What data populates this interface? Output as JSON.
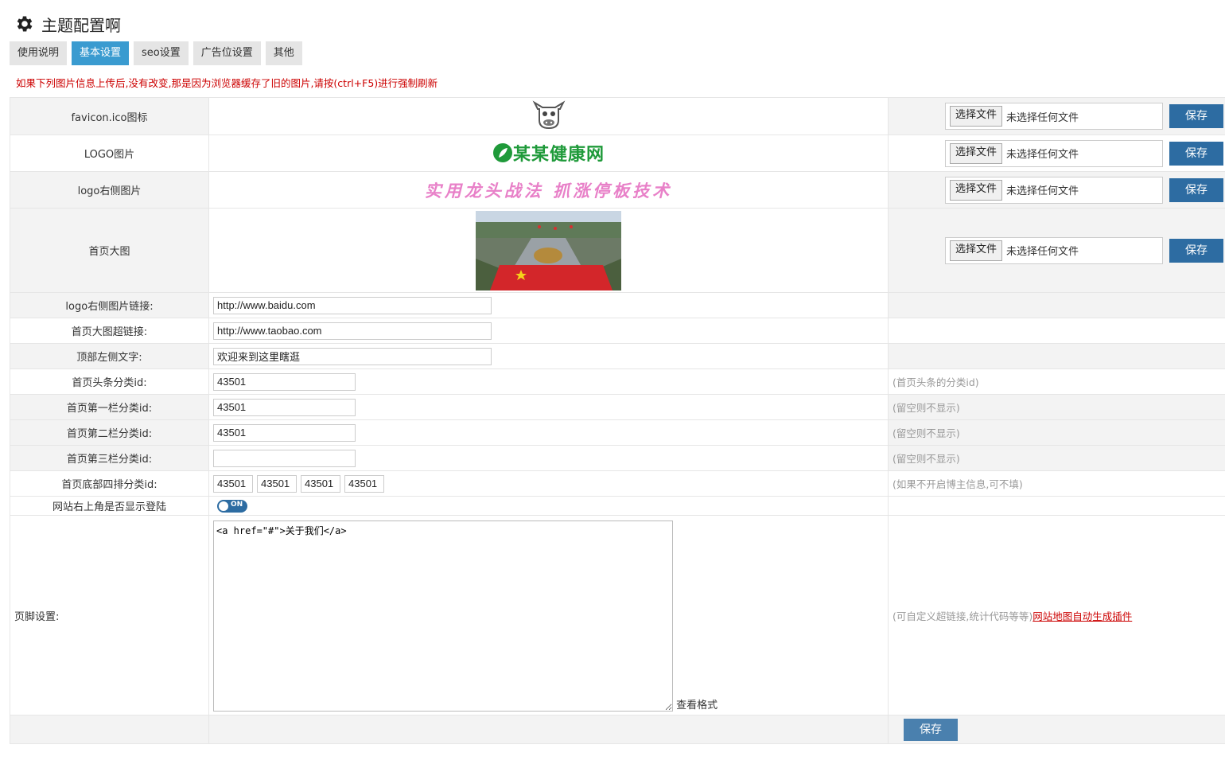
{
  "page": {
    "title": "主题配置啊",
    "gear_icon": "gear-icon"
  },
  "tabs": [
    {
      "label": "使用说明",
      "active": false
    },
    {
      "label": "基本设置",
      "active": true
    },
    {
      "label": "seo设置",
      "active": false
    },
    {
      "label": "广告位设置",
      "active": false
    },
    {
      "label": "其他",
      "active": false
    }
  ],
  "notice": "如果下列图片信息上传后,没有改变,那是因为浏览器缓存了旧的图片,请按(ctrl+F5)进行强制刷新",
  "file": {
    "button_label": "选择文件",
    "status": "未选择任何文件",
    "save_label": "保存"
  },
  "images": {
    "favicon_label": "favicon.ico图标",
    "logo_label": "LOGO图片",
    "logo_text": "某某健康网",
    "logo_right_label": "logo右侧图片",
    "logo_right_text": "实用龙头战法 抓涨停板技术",
    "banner_label": "首页大图"
  },
  "fields": {
    "logo_right_link_label": "logo右侧图片链接:",
    "logo_right_link_value": "http://www.baidu.com",
    "banner_link_label": "首页大图超链接:",
    "banner_link_value": "http://www.taobao.com",
    "top_left_text_label": "顶部左侧文字:",
    "top_left_text_value": "欢迎来到这里瞎逛",
    "headline_cat_label": "首页头条分类id:",
    "headline_cat_value": "43501",
    "headline_cat_hint": "(首页头条的分类id)",
    "col1_label": "首页第一栏分类id:",
    "col1_value": "43501",
    "col1_hint": "(留空则不显示)",
    "col2_label": "首页第二栏分类id:",
    "col2_value": "43501",
    "col2_hint": "(留空则不显示)",
    "col3_label": "首页第三栏分类id:",
    "col3_value": "",
    "col3_hint": "(留空则不显示)",
    "bottom4_label": "首页底部四排分类id:",
    "bottom4_values": [
      "43501",
      "43501",
      "43501",
      "43501"
    ],
    "bottom4_hint": "(如果不开启博主信息,可不填)",
    "login_toggle_label": "网站右上角是否显示登陆",
    "login_toggle_text": "ON",
    "login_toggle_on": true,
    "footer_label": "页脚设置:",
    "footer_value": "<a href=\"#\">关于我们</a>",
    "footer_view_format": "查看格式",
    "footer_hint": "(可自定义超链接,统计代码等等)",
    "footer_link": "网站地图自动生成插件"
  },
  "bottom_save_label": "保存"
}
